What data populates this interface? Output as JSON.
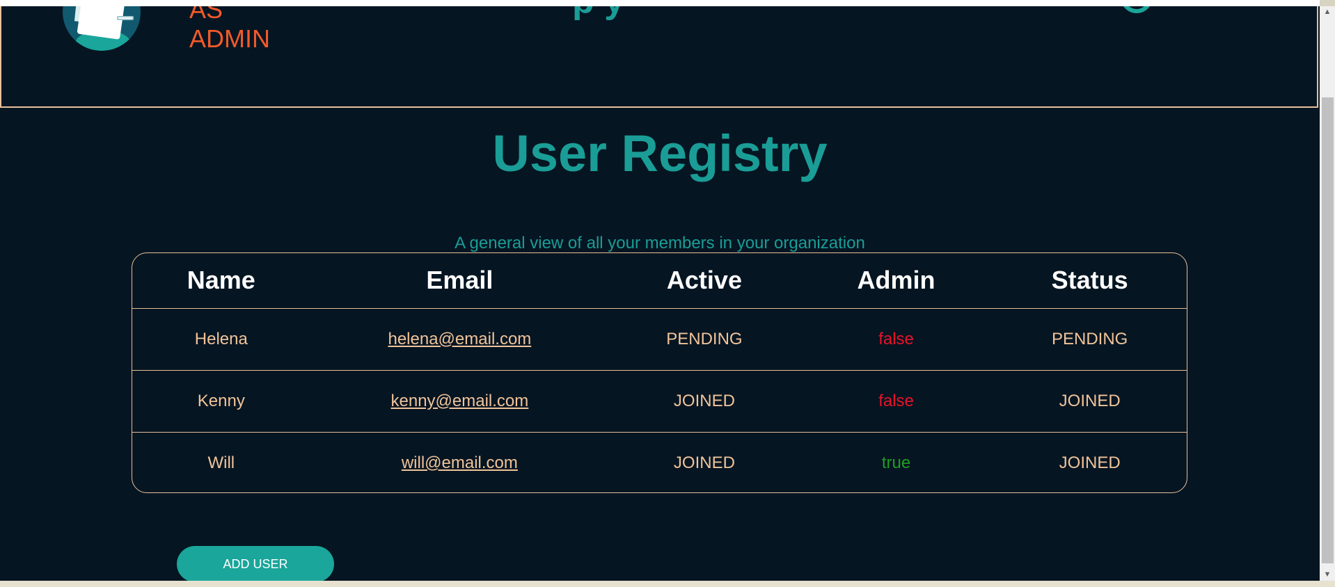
{
  "header": {
    "admin_label_line1": "AS",
    "admin_label_line2": "ADMIN",
    "title_fragment": "p y",
    "logo_icon": "clipboard-logo-icon"
  },
  "main": {
    "title": "User Registry",
    "subtitle": "A general view of all your members in your organization"
  },
  "table": {
    "columns": [
      "Name",
      "Email",
      "Active",
      "Admin",
      "Status"
    ],
    "rows": [
      {
        "name": "Helena",
        "email": "helena@email.com",
        "active": "PENDING",
        "admin": "false",
        "status": "PENDING"
      },
      {
        "name": "Kenny",
        "email": "kenny@email.com",
        "active": "JOINED",
        "admin": "false",
        "status": "JOINED"
      },
      {
        "name": "Will",
        "email": "will@email.com",
        "active": "JOINED",
        "admin": "true",
        "status": "JOINED"
      }
    ]
  },
  "actions": {
    "add_user_label": "ADD USER"
  },
  "colors": {
    "background": "#061522",
    "accent": "#1a9d96",
    "border": "#e8c19a",
    "text_cell": "#f0c49a",
    "admin_false": "#e8132a",
    "admin_true": "#1f9e22",
    "admin_label": "#f25a2a"
  },
  "scrollbar": {
    "up_icon": "scroll-up-arrow-icon",
    "down_icon": "scroll-down-arrow-icon"
  }
}
